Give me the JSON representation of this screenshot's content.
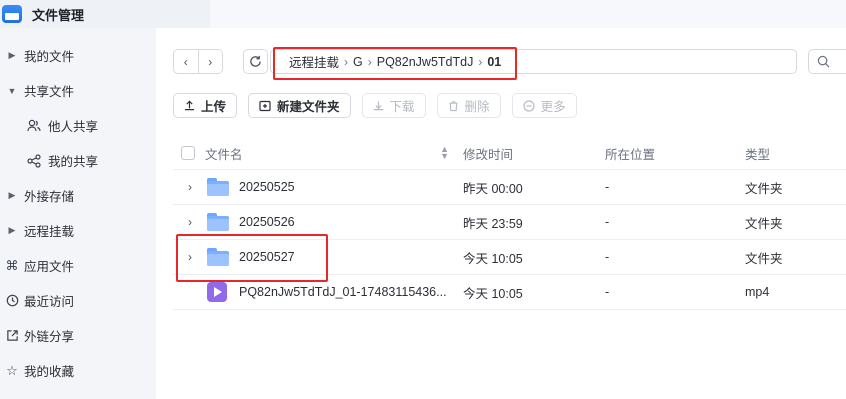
{
  "app": {
    "title": "文件管理",
    "accent": "#2f7cf0"
  },
  "sidebar": {
    "items": [
      {
        "label": "我的文件",
        "icon": "caret-right-icon"
      },
      {
        "label": "共享文件",
        "icon": "caret-down-icon"
      },
      {
        "label": "他人共享",
        "icon": "users-icon"
      },
      {
        "label": "我的共享",
        "icon": "share-icon"
      },
      {
        "label": "外接存储",
        "icon": "caret-right-icon"
      },
      {
        "label": "远程挂载",
        "icon": "caret-right-icon"
      },
      {
        "label": "应用文件",
        "icon": "command-icon"
      },
      {
        "label": "最近访问",
        "icon": "clock-icon"
      },
      {
        "label": "外链分享",
        "icon": "external-link-icon"
      },
      {
        "label": "我的收藏",
        "icon": "star-icon"
      }
    ]
  },
  "nav": {
    "back": "‹",
    "forward": "›"
  },
  "breadcrumb": [
    "远程挂载",
    "G",
    "PQ82nJw5TdTdJ",
    "01"
  ],
  "breadcrumb_sep": "›",
  "toolbar": {
    "upload": "上传",
    "new_folder": "新建文件夹",
    "download": "下载",
    "delete": "删除",
    "more": "更多"
  },
  "table": {
    "headers": {
      "name": "文件名",
      "mtime": "修改时间",
      "location": "所在位置",
      "type": "类型"
    },
    "rows": [
      {
        "name": "20250525",
        "mtime": "昨天 00:00",
        "location": "-",
        "type": "文件夹",
        "kind": "folder"
      },
      {
        "name": "20250526",
        "mtime": "昨天 23:59",
        "location": "-",
        "type": "文件夹",
        "kind": "folder"
      },
      {
        "name": "20250527",
        "mtime": "今天 10:05",
        "location": "-",
        "type": "文件夹",
        "kind": "folder"
      },
      {
        "name": "PQ82nJw5TdTdJ_01-17483115436...",
        "mtime": "今天 10:05",
        "location": "-",
        "type": "mp4",
        "kind": "video"
      }
    ]
  },
  "highlight_color": "#e8262b"
}
